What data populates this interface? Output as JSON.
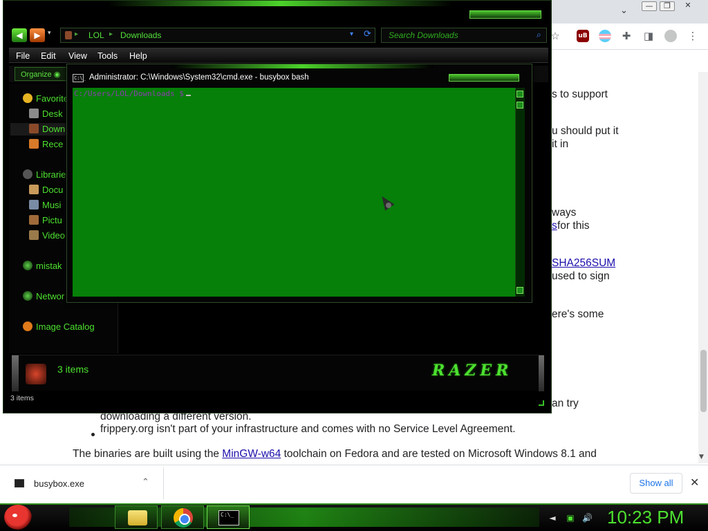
{
  "chrome": {
    "window_controls": {
      "minimize": "—",
      "restore": "❐",
      "close": "✕"
    },
    "tabstrip_chevron": "⌄",
    "toolbar_icons": [
      "star-icon",
      "ublock-icon",
      "trans-flag-icon",
      "extensions-icon",
      "sidebar-icon",
      "profile-icon",
      "menu-icon"
    ],
    "page_fragments": [
      "s to support",
      "u should put it",
      " it in",
      "ways",
      "s",
      " for this",
      "SHA256SUM",
      "used to sign",
      "ere's some",
      "an try"
    ],
    "bullet_1_cont": "downloading a different version.",
    "bullet_2": "frippery.org isn't part of your infrastructure and comes with no Service Level Agreement.",
    "para_prefix": "The binaries are built using the ",
    "para_link": "MinGW-w64",
    "para_suffix": " toolchain on Fedora and are tested on Microsoft Windows 8.1 and",
    "download": {
      "file": "busybox.exe",
      "show_all": "Show all"
    }
  },
  "explorer": {
    "nav": {
      "back": "◀",
      "forward": "▶",
      "dropdown": "▾"
    },
    "address": [
      "LOL",
      "Downloads"
    ],
    "address_sep": "▸",
    "address_dropdown": "▾",
    "refresh": "⟳",
    "search_placeholder": "Search Downloads",
    "menu": [
      "File",
      "Edit",
      "View",
      "Tools",
      "Help"
    ],
    "organize": "Organize ◉",
    "nav_items": {
      "favorites": "Favorite",
      "desktop": "Desk",
      "downloads": "Down",
      "recent": "Rece",
      "libraries": "Librarie",
      "documents": "Docu",
      "music": "Musi",
      "pictures": "Pictu",
      "videos": "Video",
      "homegroup": "mistak",
      "network": "Networ",
      "image_catalog": "Image Catalog"
    },
    "details_count": "3 items",
    "brand": "RAZER",
    "status": "3 items"
  },
  "cmd": {
    "title": "Administrator: C:\\Windows\\System32\\cmd.exe - busybox  bash",
    "icon_text": "C:\\_",
    "prompt": "C:/Users/LOL/Downloads $"
  },
  "taskbar": {
    "cmd_icon_text": "C:\\_",
    "clock": "10:23 PM",
    "tray": [
      "◄",
      "▣",
      "🔊"
    ]
  },
  "colors": {
    "accent_green": "#4ce12f",
    "terminal_bg": "#068008",
    "link_blue": "#1a0dab"
  }
}
